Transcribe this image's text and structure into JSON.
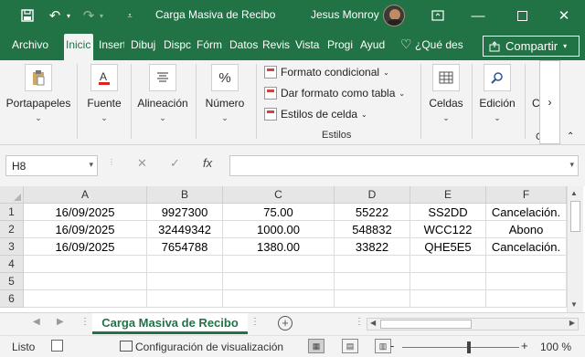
{
  "titlebar": {
    "title": "Carga Masiva de Recibo",
    "user": "Jesus Monroy",
    "icons": [
      "save-icon",
      "undo-icon",
      "undo-dropdown-icon",
      "redo-icon",
      "redo-dropdown-icon",
      "customize-toolbar-icon",
      "ribbon-display-icon",
      "minimize-icon",
      "maximize-icon",
      "close-icon"
    ]
  },
  "tabs": [
    "Archivo",
    "Inicio",
    "Insertar",
    "Dibujar",
    "Disposición",
    "Fórmulas",
    "Datos",
    "Revisar",
    "Vista",
    "Programador",
    "Ayuda"
  ],
  "tab_display": [
    "Archivo",
    "Inicic",
    "Insert",
    "Dibuj",
    "Dispc",
    "Fórm",
    "Datos",
    "Revis",
    "Vista",
    "Progi",
    "Ayud"
  ],
  "tellme": "¿Qué des",
  "share": "Compartir",
  "ribbon": {
    "portapapeles": "Portapapeles",
    "fuente": "Fuente",
    "alineacion": "Alineación",
    "numero": "Número",
    "numero_icon": "%",
    "formato_condicional": "Formato condicional",
    "dar_formato": "Dar formato como tabla",
    "estilos_celda": "Estilos de celda",
    "estilos_group": "Estilos",
    "celdas": "Celdas",
    "edicion": "Edición",
    "more": "›",
    "cut_off": "C"
  },
  "formula_bar": {
    "name_box": "H8",
    "formula": ""
  },
  "sheet": {
    "columns": [
      "A",
      "B",
      "C",
      "D",
      "E",
      "F"
    ],
    "rows": [
      {
        "num": "1",
        "cells": [
          "16/09/2025",
          "9927300",
          "75.00",
          "55222",
          "SS2DD",
          "Cancelación."
        ]
      },
      {
        "num": "2",
        "cells": [
          "16/09/2025",
          "32449342",
          "1000.00",
          "548832",
          "WCC122",
          "Abono"
        ]
      },
      {
        "num": "3",
        "cells": [
          "16/09/2025",
          "7654788",
          "1380.00",
          "33822",
          "QHE5E5",
          "Cancelación."
        ]
      },
      {
        "num": "4",
        "cells": [
          "",
          "",
          "",
          "",
          "",
          ""
        ]
      },
      {
        "num": "5",
        "cells": [
          "",
          "",
          "",
          "",
          "",
          ""
        ]
      },
      {
        "num": "6",
        "cells": [
          "",
          "",
          "",
          "",
          "",
          ""
        ]
      }
    ]
  },
  "sheet_tab": "Carga Masiva de Recibo",
  "status": {
    "mode": "Listo",
    "display_settings": "Configuración de visualización",
    "zoom": "100 %"
  }
}
